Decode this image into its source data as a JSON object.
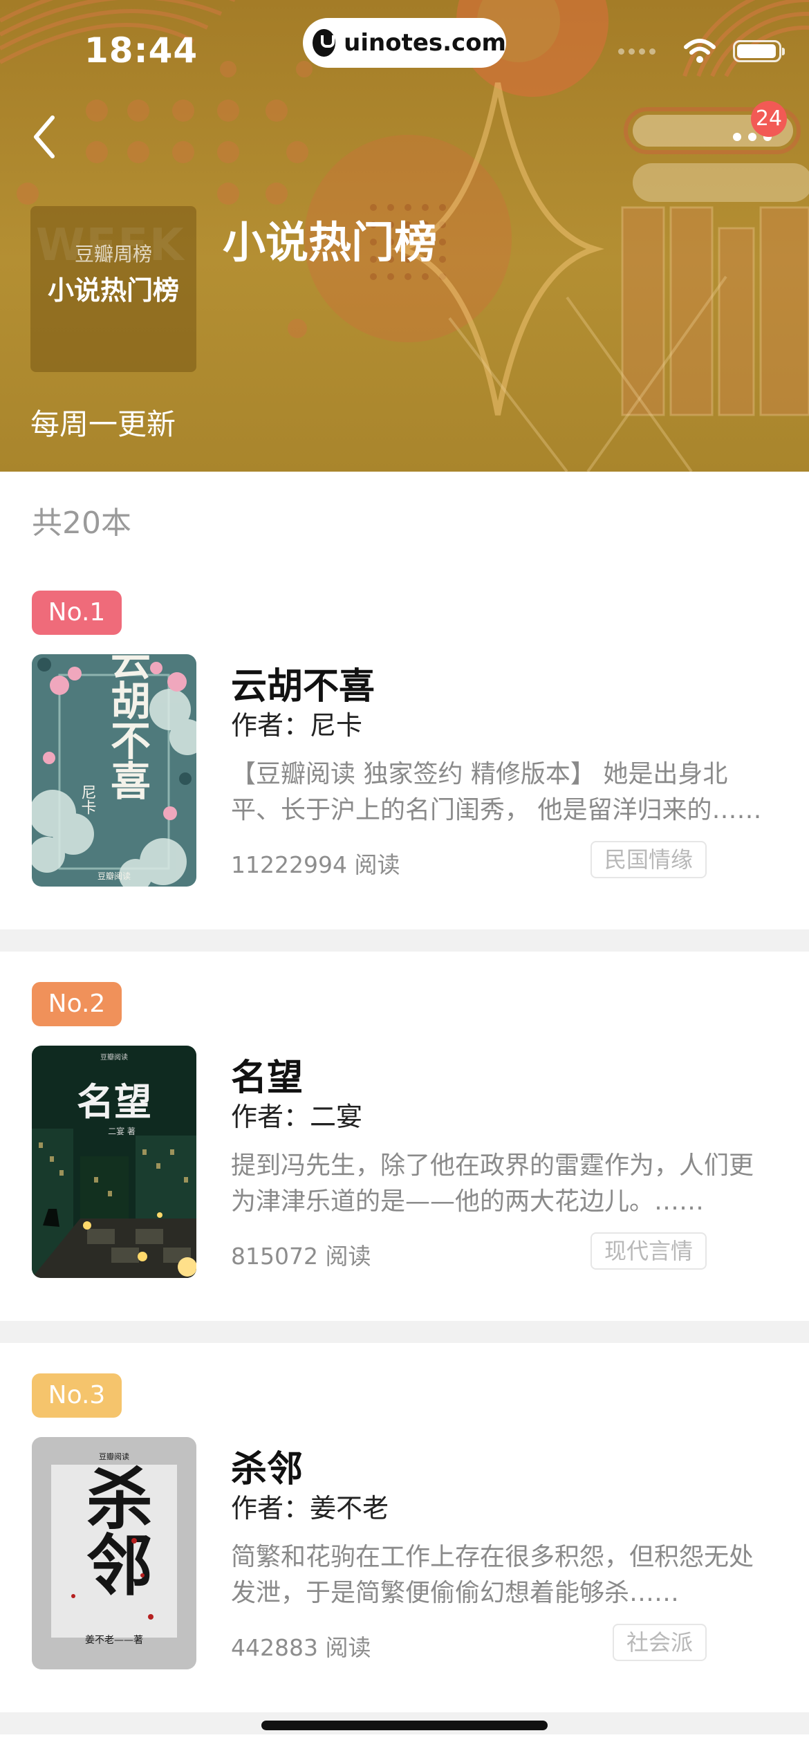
{
  "status_bar": {
    "time": "18:44",
    "url": "uinotes.com"
  },
  "header": {
    "badge_count": "24",
    "cover_watermark": "WEEK",
    "cover_subtitle": "豆瓣周榜",
    "cover_title": "小说热门榜",
    "title": "小说热门榜",
    "update_note": "每周一更新"
  },
  "list": {
    "total": "共20本",
    "books": [
      {
        "rank": "No.1",
        "rank_color": "#ef6b7a",
        "title": "云胡不喜",
        "author": "作者：尼卡",
        "description": "【豆瓣阅读 独家签约 精修版本】 她是出身北平、长于沪上的名门闺秀， 他是留洋归来的……",
        "reads": "11222994 阅读",
        "tag": "民国情缘",
        "cover_title": "云胡不喜",
        "cover_author": "尼卡",
        "cover_brand": "豆瓣阅读"
      },
      {
        "rank": "No.2",
        "rank_color": "#f0915a",
        "title": "名望",
        "author": "作者：二宴",
        "description": "提到冯先生，除了他在政界的雷霆作为，人们更为津津乐道的是——他的两大花边儿。……",
        "reads": "815072 阅读",
        "tag": "现代言情",
        "cover_title": "名望",
        "cover_author": "二宴 著",
        "cover_brand": "豆瓣阅读"
      },
      {
        "rank": "No.3",
        "rank_color": "#f5c46c",
        "title": "杀邻",
        "author": "作者：姜不老",
        "description": "简繁和花驹在工作上存在很多积怨，但积怨无处发泄，于是简繁便偷偷幻想着能够杀……",
        "reads": "442883 阅读",
        "tag": "社会派",
        "cover_title": "杀邻",
        "cover_author": "姜不老——著",
        "cover_brand": "豆瓣阅读"
      }
    ]
  }
}
